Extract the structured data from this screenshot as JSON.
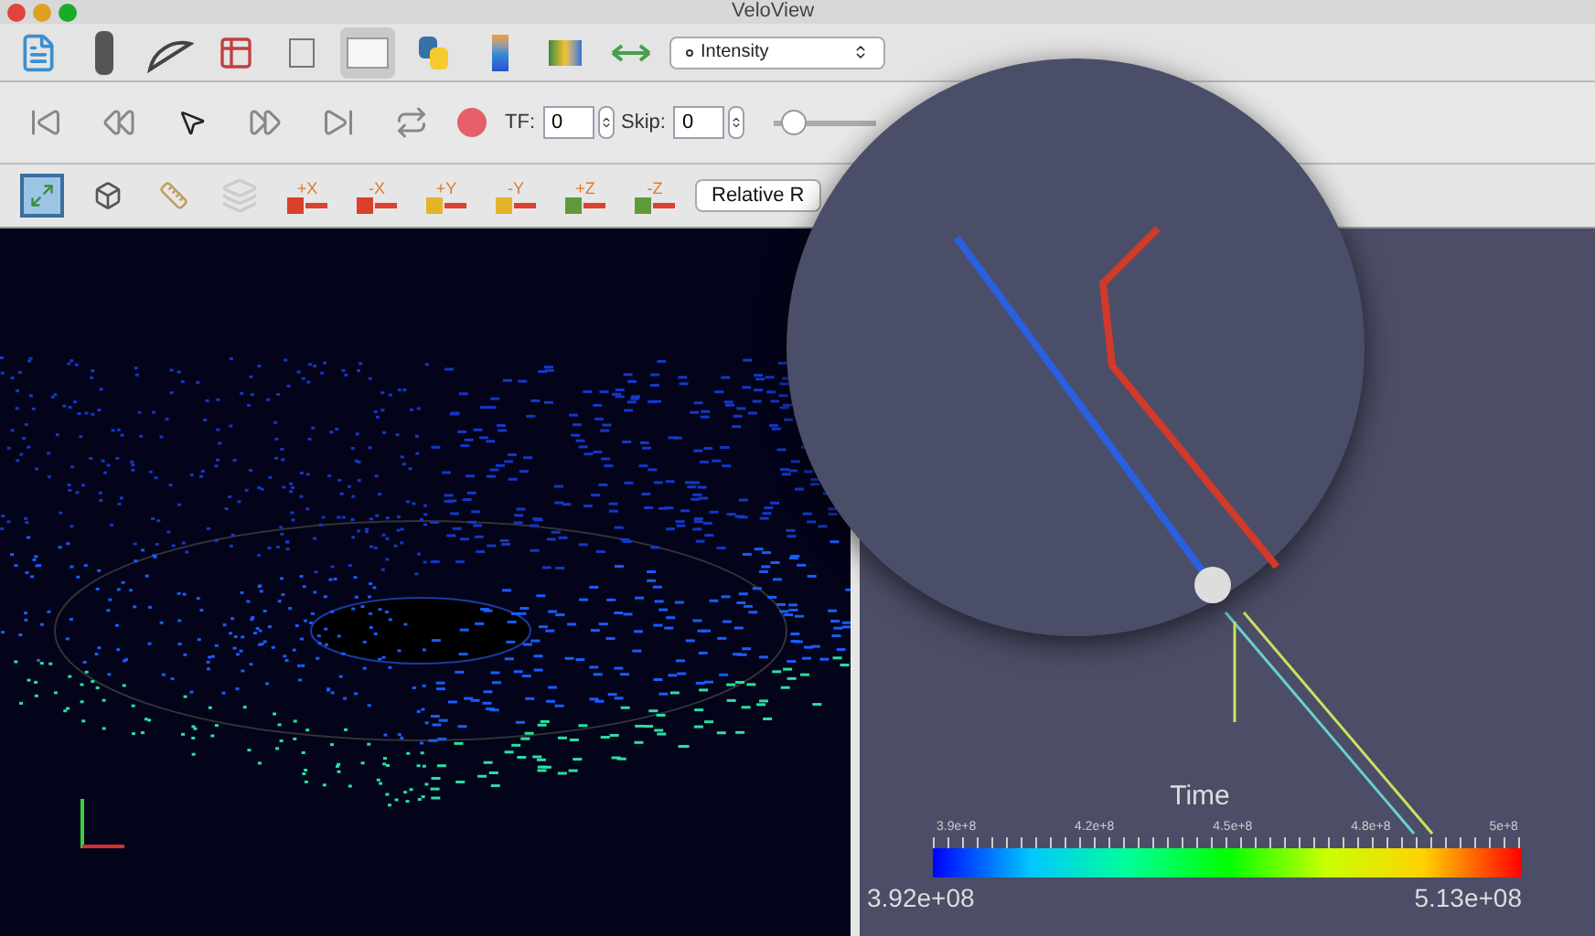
{
  "window": {
    "title": "VeloView"
  },
  "main_toolbar": {
    "color_by": "Intensity"
  },
  "playback_toolbar": {
    "tf_label": "TF:",
    "tf_value": "0",
    "skip_label": "Skip:",
    "skip_value": "0",
    "slider": {
      "level": 0.2
    }
  },
  "view_toolbar": {
    "axis_buttons": [
      {
        "label": "+X",
        "color": "#d9412b"
      },
      {
        "label": "-X",
        "color": "#d9412b"
      },
      {
        "label": "+Y",
        "color": "#e3b32a"
      },
      {
        "label": "-Y",
        "color": "#e3b32a"
      },
      {
        "label": "+Z",
        "color": "#5f9a3a"
      },
      {
        "label": "-Z",
        "color": "#5f9a3a"
      }
    ],
    "relative_button": "Relative R"
  },
  "scalar_bar": {
    "title": "Time",
    "ticks": [
      "3.9e+8",
      "4.2e+8",
      "4.5e+8",
      "4.8e+8",
      "5e+8"
    ],
    "min": "3.92e+08",
    "max": "5.13e+08"
  }
}
